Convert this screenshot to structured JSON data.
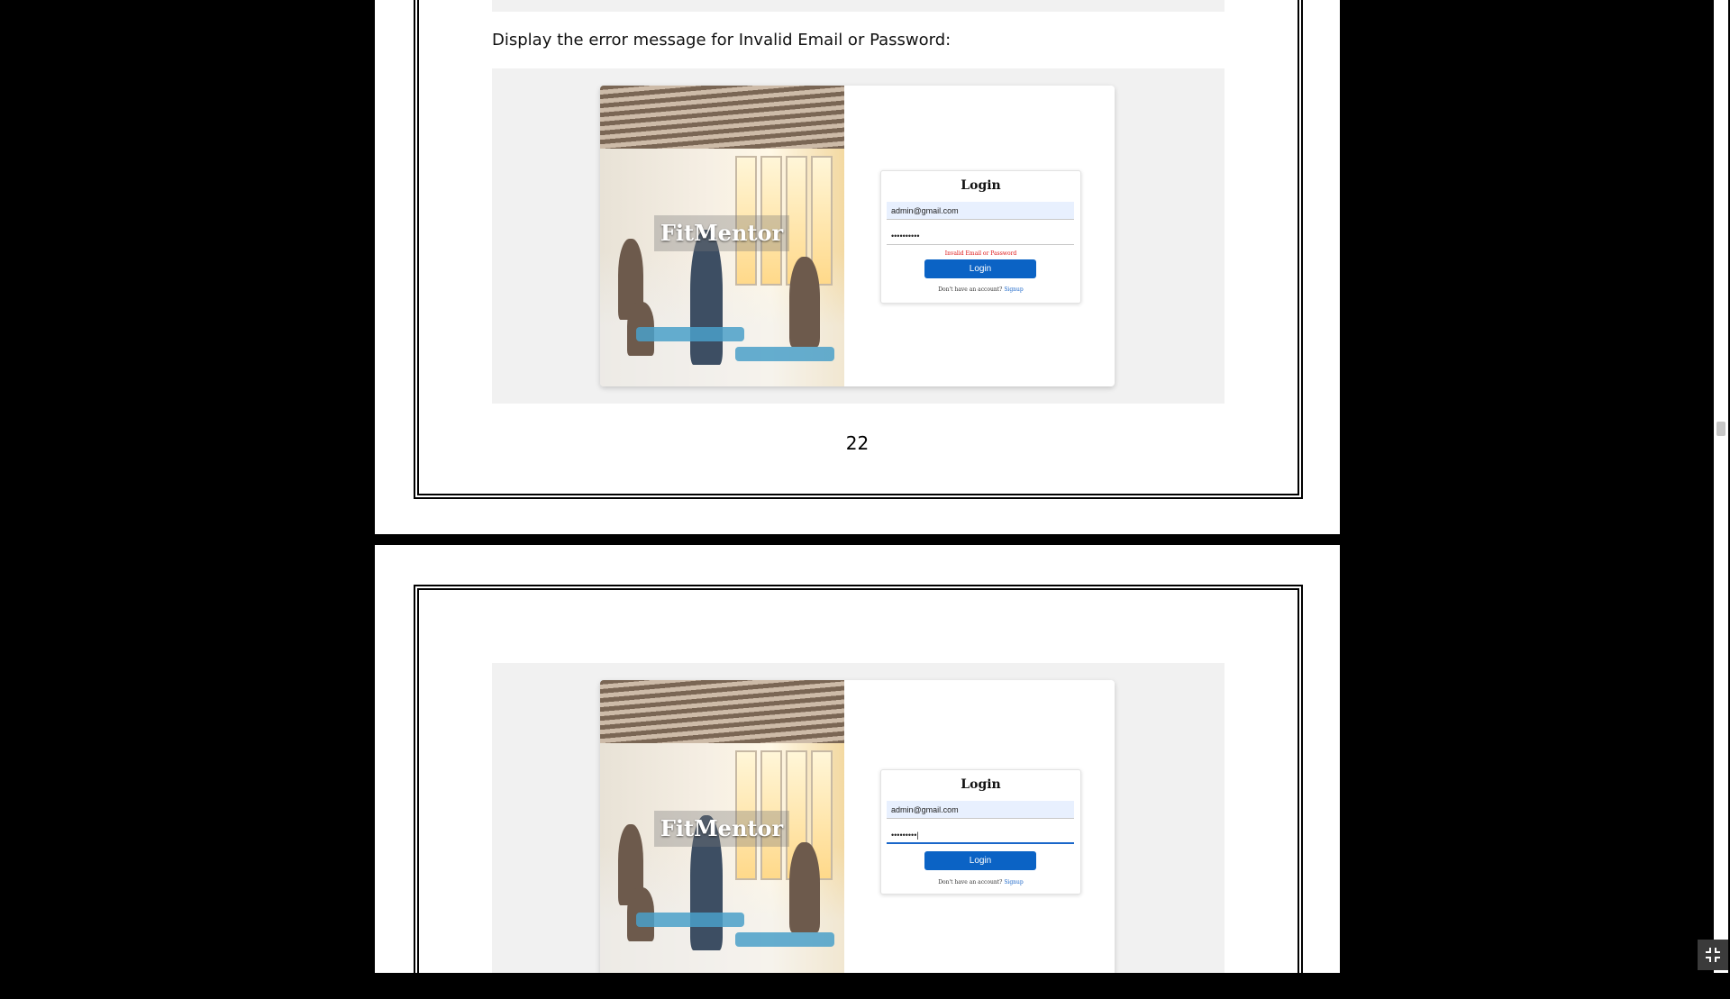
{
  "document": {
    "caption": "Display the error message for Invalid Email or Password:",
    "page_number": "22"
  },
  "screenshot_error": {
    "brand": "FitMentor",
    "login_title": "Login",
    "email_value": "admin@gmail.com",
    "password_value": "••••••••••",
    "error_message": "Invalid Email or Password",
    "login_button": "Login",
    "signup_prompt": "Don't have an account?",
    "signup_link": "Signup"
  },
  "screenshot_typing": {
    "brand": "FitMentor",
    "login_title": "Login",
    "email_value": "admin@gmail.com",
    "password_value": "•••••••••|",
    "login_button": "Login",
    "signup_prompt": "Don't have an account?",
    "signup_link": "Signup"
  },
  "icons": {
    "exit_fullscreen": "exit-fullscreen-icon"
  },
  "colors": {
    "background": "#000000",
    "page": "#ffffff",
    "button": "#0b63c5",
    "error": "#dd1111",
    "link": "#1a66c9"
  }
}
